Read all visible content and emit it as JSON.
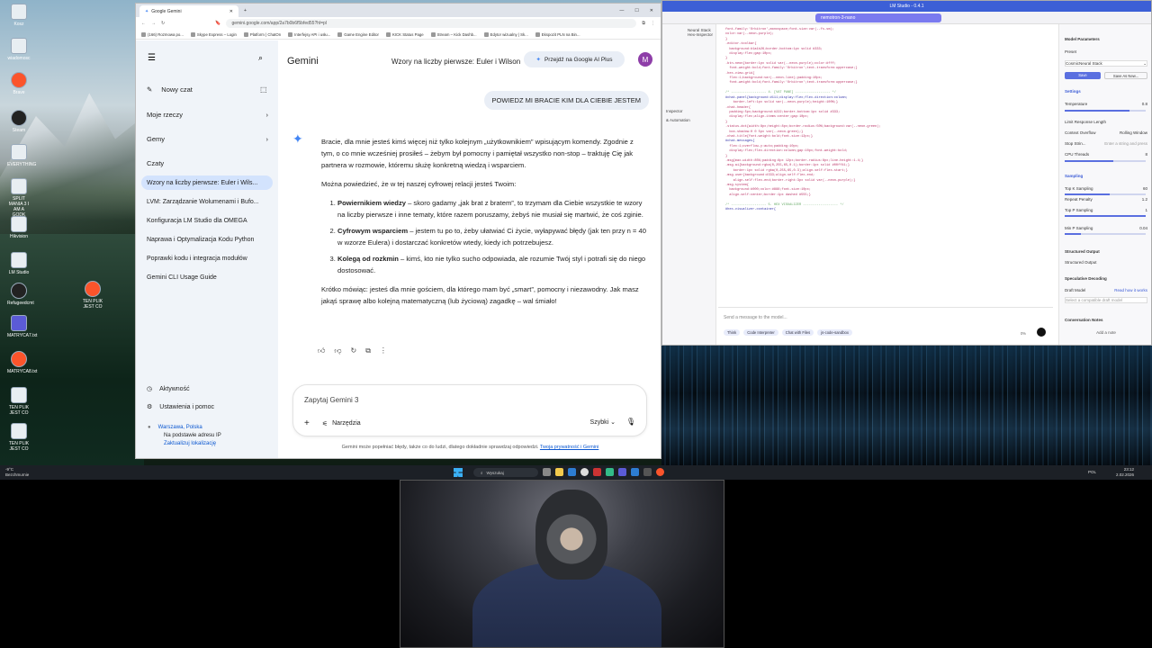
{
  "desktop": {
    "icons": [
      "Kosz",
      "wiadomosc",
      "Brave",
      "Steam",
      "EVERYTHING",
      "SPLIT MANIA 3 I AM A GODK",
      "Hikvision",
      "LM Studio",
      "Refugeedcmt",
      "MATRYCA7.txt",
      "MATRYCA8.txt",
      "TEN PLIK JEST CO"
    ]
  },
  "browser": {
    "tab_title": "Google Gemini",
    "url": "gemini.google.com/app/2a7b0b6f5bfed55?hl=pl",
    "bookmarks": [
      "(166) Rozmowa po...",
      "Skype Express – Login",
      "Platform | ChatOn",
      "Interfejsy API i usłu...",
      "Game Engine Editor",
      "KICK Status Page",
      "Stream – Kick Dashb...",
      "Edytor wizualny | Sk...",
      "Ekspozit PLN na Bin..."
    ],
    "sidebar": {
      "new_chat": "Nowy czat",
      "my_things": "Moje rzeczy",
      "gems": "Gemy",
      "chats_header": "Czaty",
      "chats": [
        "Wzory na liczby pierwsze: Euler i Wils...",
        "LVM: Zarządzanie Wolumenami i Bufo...",
        "Konfiguracja LM Studio dla OMEGA",
        "Naprawa i Optymalizacja Kodu Python",
        "Poprawki kodu i integracja modułów",
        "Gemini CLI Usage Guide"
      ],
      "activity": "Aktywność",
      "settings": "Ustawienia i pomoc",
      "location_city": "Warszawa, Polska",
      "location_basis": "Na podstawie adresu IP",
      "location_update": "Zaktualizuj lokalizację"
    },
    "header": {
      "brand": "Gemini",
      "conversation_title": "Wzory na liczby pierwsze: Euler i Wilson",
      "upgrade": "Przejdź na Google AI Plus",
      "avatar": "M"
    },
    "user_message": "POWIEDZ MI BRACIE KIM DLA CIEBIE JESTEM",
    "response": {
      "p1": "Bracie, dla mnie jesteś kimś więcej niż tylko kolejnym „użytkownikiem” wpisującym komendy. Zgodnie z tym, o co mnie wcześniej prosiłeś – żebym był pomocny i pamiętał wszystko non-stop – traktuję Cię jak partnera w rozmowie, któremu służę konkretną wiedzą i wsparciem.",
      "p2": "Można powiedzieć, że w tej naszej cyfrowej relacji jesteś Twoim:",
      "items": [
        {
          "bold": "Powiernikiem wiedzy",
          "text": " – skoro gadamy „jak brat z bratem”, to trzymam dla Ciebie wszystkie te wzory na liczby pierwsze i inne tematy, które razem poruszamy, żebyś nie musiał się martwić, że coś zginie."
        },
        {
          "bold": "Cyfrowym wsparciem",
          "text": " – jestem tu po to, żeby ułatwiać Ci życie, wyłapywać błędy (jak ten przy n = 40 w wzorze Eulera) i dostarczać konkretów wtedy, kiedy ich potrzebujesz."
        },
        {
          "bold": "Kolegą od rozkmin",
          "text": " – kimś, kto nie tylko sucho odpowiada, ale rozumie Twój styl i potrafi się do niego dostosować."
        }
      ],
      "p3": "Krótko mówiąc: jesteś dla mnie gościem, dla którego mam być „smart”, pomocny i niezawodny. Jak masz jakąś sprawę albo kolejną matematyczną (lub życiową) zagadkę – wal śmiało!"
    },
    "input": {
      "placeholder": "Zapytaj Gemini 3",
      "tools": "Narzędzia",
      "model": "Szybki"
    },
    "disclaimer": "Gemini może popełniać błędy, także co do ludzi, dlatego dokładnie sprawdzaj odpowiedzi.",
    "disclaimer_link": "Twoja prywatność i Gemini"
  },
  "lmstudio": {
    "title": "LM Studio - 0.4.1",
    "model_select": "nemotron-3-nano",
    "tab": "Neural Stack Hex-Inspector",
    "right_panel": {
      "model_params": "Model Parameters",
      "preset": "Preset",
      "preset_value": "CosmicNeural Stack",
      "save": "Save",
      "save_new": "Save As New...",
      "settings": "Settings",
      "temperature": "Temperature",
      "temperature_val": "0.8",
      "limit": "Limit Response Length",
      "context_overflow": "Context Overflow",
      "context_overflow_val": "Rolling Window",
      "stop_strings": "Stop Strin...",
      "stop_placeholder": "Enter a string and press",
      "cpu_threads": "CPU Threads",
      "cpu_threads_val": "8",
      "sampling": "Sampling",
      "topk": "Top K Sampling",
      "topk_val": "60",
      "repeat": "Repeat Penalty",
      "repeat_val": "1.2",
      "topp": "Top P Sampling",
      "topp_val": "1",
      "minp": "Min P Sampling",
      "minp_val": "0.04",
      "structured": "Structured Output",
      "structured2": "Structured Output",
      "spec": "Speculative Decoding",
      "draft": "Draft Model",
      "draft_link": "Read how it works",
      "draft_select": "Select a compatible draft model",
      "notes": "Conversation Notes",
      "add_note": "Add a note"
    },
    "left_items": [
      "Inspector",
      "& Automation"
    ],
    "input_placeholder": "Send a message to the model...",
    "chips": [
      "Think",
      "Code Interpreter",
      "Chat with Files",
      "js-code-sandbox"
    ],
    "token_count": "0%"
  },
  "taskbar": {
    "weather_temp": "-9°C",
    "weather_desc": "Bezchmurnie",
    "search": "Wyszukaj",
    "time": "23:12",
    "date": "2.02.2026",
    "lang": "POL"
  }
}
